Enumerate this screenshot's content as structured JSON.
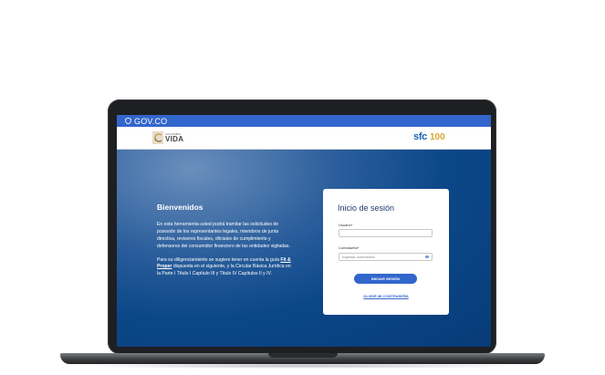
{
  "govbar": {
    "label": "GOV.CO",
    "color": "#3366cc"
  },
  "header": {
    "left_logo": {
      "small_text": "COLOMBIA",
      "big_text": "VIDA"
    },
    "right_logo": {
      "sfc": "sfc",
      "anniversary": "100"
    }
  },
  "welcome": {
    "title": "Bienvenidos",
    "paragraph1": "En esta herramienta usted podrá tramitar las solicitudes de posesión de los representantes legales, miembros de junta directiva, revisores fiscales, oficiales de cumplimiento y defensores del consumidor financiero de las entidades vigiladas.",
    "paragraph2_before": "Para su diligenciamiento se sugiere tener en cuenta la guía ",
    "paragraph2_link": "Fit & Proper",
    "paragraph2_after": " dispuesta en el siguiente, y la Circular Básica Jurídica en la Parte I Título I Capítulo III y Título IV Capítulos II y IV."
  },
  "login": {
    "title": "Inicio de sesión",
    "user_label": "Usuario*",
    "user_value": "",
    "password_label": "Contraseña*",
    "password_placeholder": "Ingresar contraseña",
    "submit_label": "INICIAR SESIÓN",
    "forgot_label": "OLVIDÉ MI CONTRASEÑA"
  }
}
